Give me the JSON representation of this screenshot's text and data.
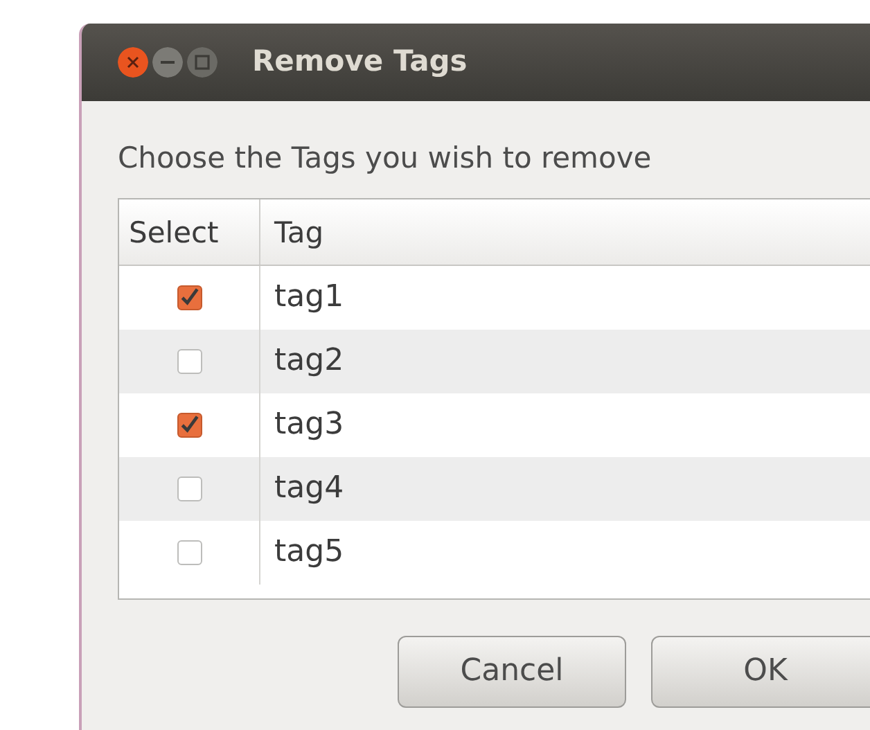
{
  "window": {
    "title": "Remove Tags"
  },
  "instruction": "Choose the Tags you wish to remove",
  "table": {
    "columns": [
      "Select",
      "Tag"
    ],
    "rows": [
      {
        "tag": "tag1",
        "checked": true
      },
      {
        "tag": "tag2",
        "checked": false
      },
      {
        "tag": "tag3",
        "checked": true
      },
      {
        "tag": "tag4",
        "checked": false
      },
      {
        "tag": "tag5",
        "checked": false
      }
    ]
  },
  "buttons": [
    "Cancel",
    "OK"
  ]
}
